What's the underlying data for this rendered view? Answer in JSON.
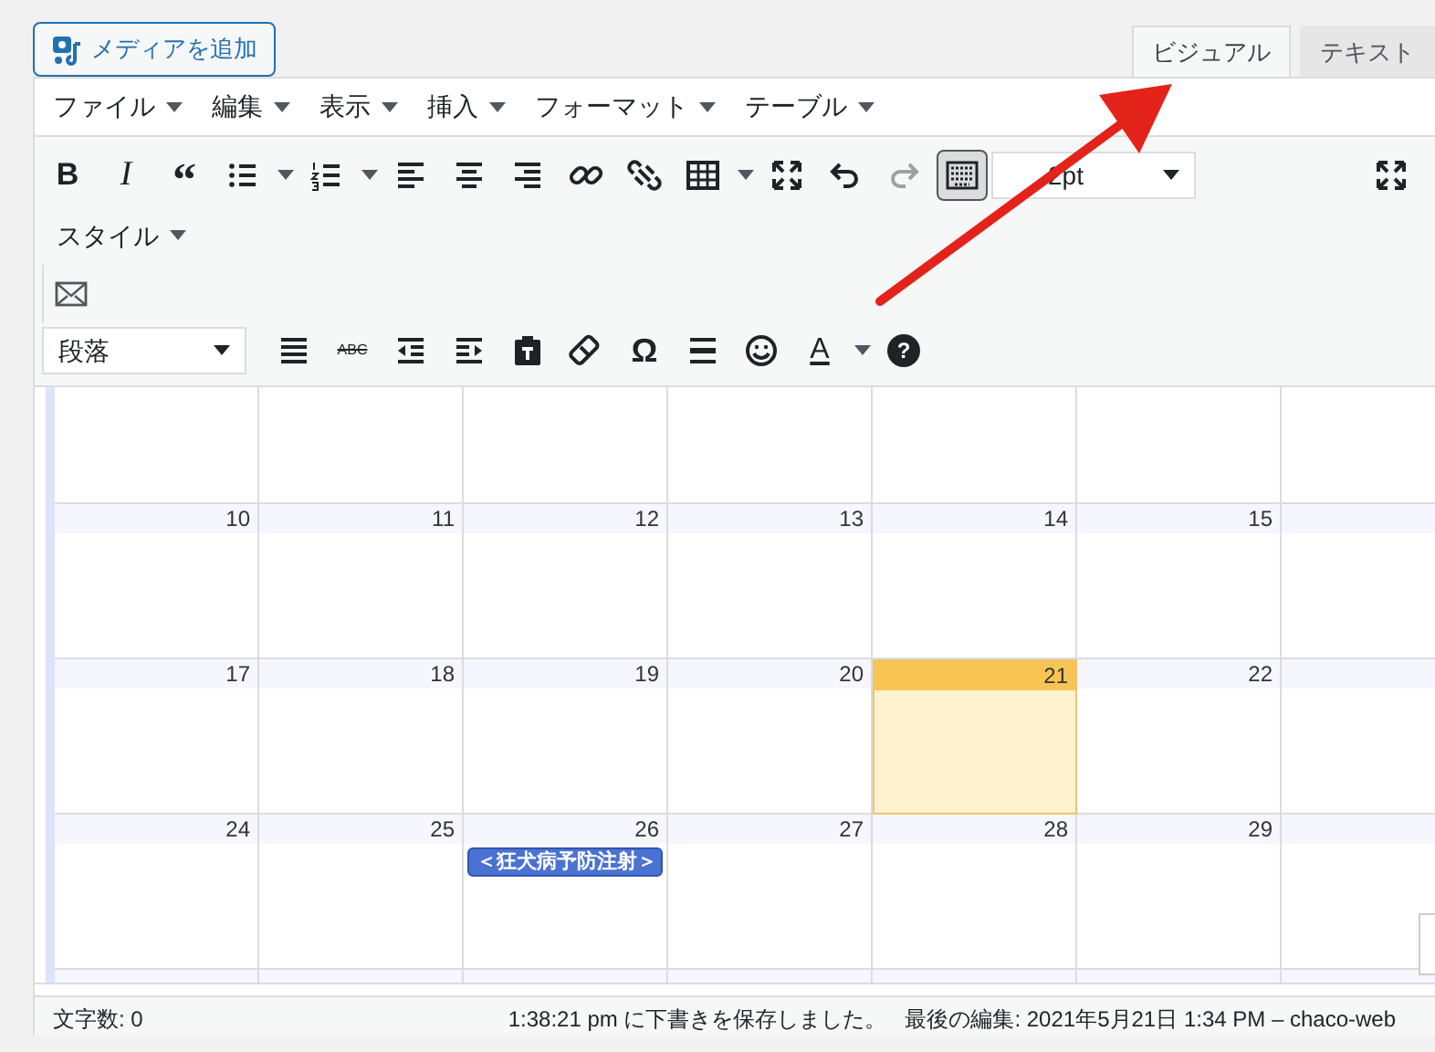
{
  "media_button": {
    "label": "メディアを追加"
  },
  "tabs": [
    {
      "label": "ビジュアル",
      "selected": true
    },
    {
      "label": "テキスト",
      "selected": false
    }
  ],
  "menus": [
    {
      "label": "ファイル"
    },
    {
      "label": "編集"
    },
    {
      "label": "表示"
    },
    {
      "label": "挿入"
    },
    {
      "label": "フォーマット"
    },
    {
      "label": "テーブル"
    }
  ],
  "toolbar_row_1": [
    {
      "kind": "bold",
      "text": "B"
    },
    {
      "kind": "italic",
      "text": "I"
    },
    {
      "kind": "quote",
      "text": "“"
    },
    {
      "kind": "bullets",
      "dropdown": true
    },
    {
      "kind": "numbers",
      "dropdown": true
    },
    {
      "kind": "alignleft"
    },
    {
      "kind": "aligncenter"
    },
    {
      "kind": "alignright"
    },
    {
      "kind": "link"
    },
    {
      "kind": "unlink"
    },
    {
      "kind": "table",
      "dropdown": true
    },
    {
      "kind": "fullscreen"
    },
    {
      "kind": "undo",
      "disabled": false
    },
    {
      "kind": "redo",
      "disabled": true
    },
    {
      "kind": "keyboard",
      "pressed": true
    }
  ],
  "font_size_select": {
    "value": "2pt"
  },
  "style_menu": {
    "label": "スタイル"
  },
  "format_select": {
    "value": "段落"
  },
  "toolbar_row_4": [
    {
      "kind": "justify"
    },
    {
      "kind": "strike",
      "text": "ABC"
    },
    {
      "kind": "outdent"
    },
    {
      "kind": "indent"
    },
    {
      "kind": "paste"
    },
    {
      "kind": "eraser"
    },
    {
      "kind": "omega",
      "text": "Ω"
    },
    {
      "kind": "hr"
    },
    {
      "kind": "smiley"
    },
    {
      "kind": "textcolor",
      "text": "A",
      "dropdown": true
    },
    {
      "kind": "help",
      "text": "?"
    }
  ],
  "calendar": {
    "weeks": [
      {
        "days": [
          {
            "day": "10",
            "today": false
          },
          {
            "day": "11",
            "today": false
          },
          {
            "day": "12",
            "today": false
          },
          {
            "day": "13",
            "today": false
          },
          {
            "day": "14",
            "today": false
          },
          {
            "day": "15",
            "today": false
          }
        ]
      },
      {
        "days": [
          {
            "day": "17",
            "today": false
          },
          {
            "day": "18",
            "today": false
          },
          {
            "day": "19",
            "today": false
          },
          {
            "day": "20",
            "today": false
          },
          {
            "day": "21",
            "today": true
          },
          {
            "day": "22",
            "today": false
          }
        ]
      },
      {
        "days": [
          {
            "day": "24",
            "today": false
          },
          {
            "day": "25",
            "today": false
          },
          {
            "day": "26",
            "today": false,
            "events": [
              "＜狂犬病予防注射＞"
            ]
          },
          {
            "day": "27",
            "today": false
          },
          {
            "day": "28",
            "today": false
          },
          {
            "day": "29",
            "today": false
          }
        ]
      }
    ]
  },
  "status_bar": {
    "word_count": "文字数: 0",
    "saved": "1:38:21 pm に下書きを保存しました。",
    "last_edit": "最後の編集: 2021年5月21日 1:34 PM – chaco-web"
  }
}
